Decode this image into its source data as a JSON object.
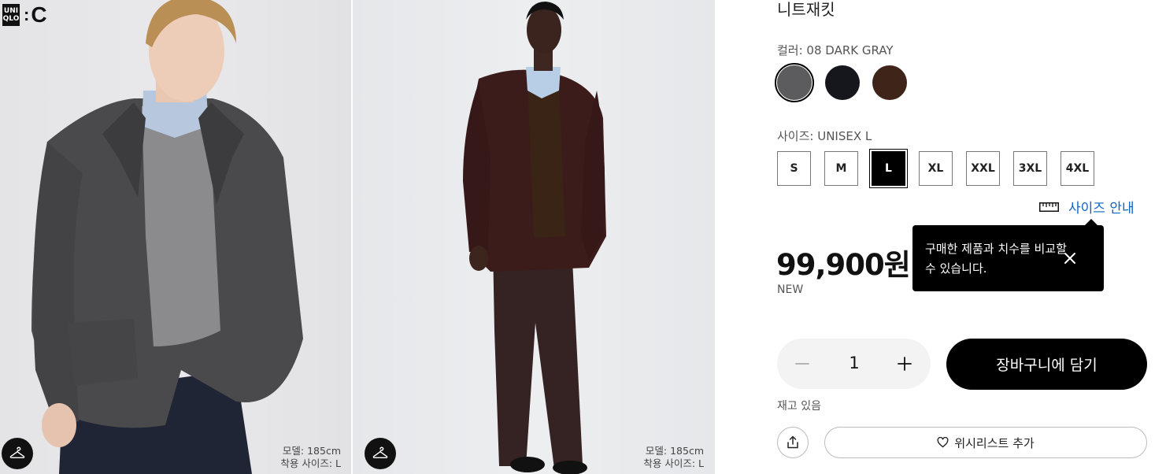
{
  "brand": {
    "logo_line1": "UNI",
    "logo_line2": "QLO",
    "sub_brand": "C"
  },
  "gallery": [
    {
      "model_height": "모델: 185cm",
      "fit_size": "착용 사이즈: L"
    },
    {
      "model_height": "모델: 185cm",
      "fit_size": "착용 사이즈: L"
    }
  ],
  "product": {
    "title": "니트재킷",
    "color_label": "컬러: 08 DARK GRAY",
    "colors": [
      {
        "name": "08 DARK GRAY",
        "hex": "#5c5c5e",
        "selected": true
      },
      {
        "name": "BLACK",
        "hex": "#16171c",
        "selected": false
      },
      {
        "name": "DARK BROWN",
        "hex": "#3f2419",
        "selected": false
      }
    ],
    "size_label": "사이즈: UNISEX L",
    "sizes": [
      "S",
      "M",
      "L",
      "XL",
      "XXL",
      "3XL",
      "4XL"
    ],
    "selected_size": "L",
    "size_guide": "사이즈 안내",
    "tooltip": "구매한 제품과 치수를 비교할 수 있습니다.",
    "price": "99,900원",
    "badge": "NEW",
    "quantity": "1",
    "add_to_cart": "장바구니에 담기",
    "stock": "재고 있음",
    "wishlist": "위시리스트 추가"
  }
}
